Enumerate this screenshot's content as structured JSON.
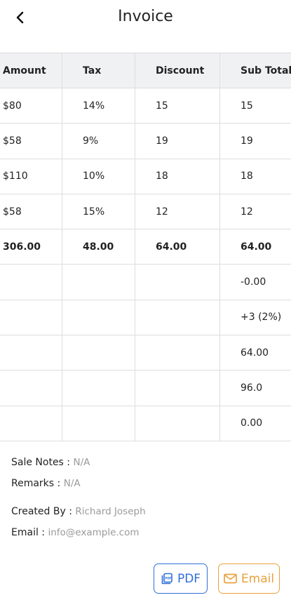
{
  "header": {
    "title": "Invoice"
  },
  "table": {
    "columns": [
      "Amount",
      "Tax",
      "Discount",
      "Sub Total"
    ],
    "rows": [
      [
        "$80",
        "14%",
        "15",
        "15"
      ],
      [
        "$58",
        "9%",
        "19",
        "19"
      ],
      [
        "$110",
        "10%",
        "18",
        "18"
      ],
      [
        "$58",
        "15%",
        "12",
        "12"
      ]
    ],
    "totals": [
      "306.00",
      "48.00",
      "64.00",
      "64.00"
    ],
    "summary": [
      "-0.00",
      "+3 (2%)",
      "64.00",
      "96.0",
      "0.00"
    ]
  },
  "notes": {
    "sale_notes_label": "Sale Notes :",
    "sale_notes_value": "N/A",
    "remarks_label": "Remarks :",
    "remarks_value": "N/A",
    "created_by_label": "Created By :",
    "created_by_value": "Richard Joseph",
    "email_label": "Email :",
    "email_value": "info@example.com"
  },
  "actions": {
    "pdf_label": "PDF",
    "email_label": "Email"
  },
  "colors": {
    "pdf": "#2f6fd8",
    "email": "#e8a23c",
    "header_bg": "#f0f1f3"
  },
  "icons": {
    "back": "chevron-left-icon",
    "pdf": "pdf-file-icon",
    "email": "envelope-icon"
  }
}
